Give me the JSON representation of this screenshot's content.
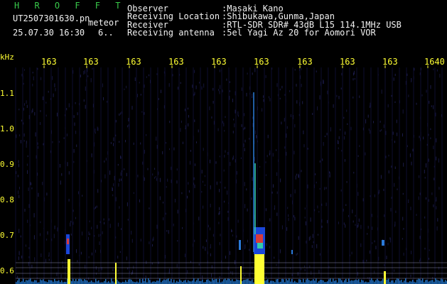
{
  "header": {
    "title": "H R O F F T",
    "filename": "UT2507301630.pn",
    "mode": "meteor",
    "date": "25.07.30 16:30",
    "count": "6.."
  },
  "info": {
    "observer_label": "Observer",
    "observer_value": ":Masaki Kano",
    "location_label": "Receiving Location",
    "location_value": ":Shibukawa,Gunma,Japan",
    "receiver_label": "Receiver",
    "receiver_value": ":RTL-SDR SDR# 43dB L15 114.1MHz USB",
    "antenna_label": "Receiving antenna",
    "antenna_value": ":5el Yagi Az 20 for Aomori VOR"
  },
  "axis": {
    "unit": "kHz",
    "top_ticks": [
      "163",
      "163",
      "163",
      "163",
      "163",
      "163",
      "163",
      "163",
      "163",
      "1640"
    ],
    "y_ticks": [
      "1.1",
      "1.0",
      "0.9",
      "0.8",
      "0.7",
      "0.6"
    ]
  },
  "colors": {
    "title": "#38c94a",
    "text": "#f2f2f2",
    "ticks": "#ffff33",
    "grid": "#2a2a5a",
    "background": "#000000"
  }
}
